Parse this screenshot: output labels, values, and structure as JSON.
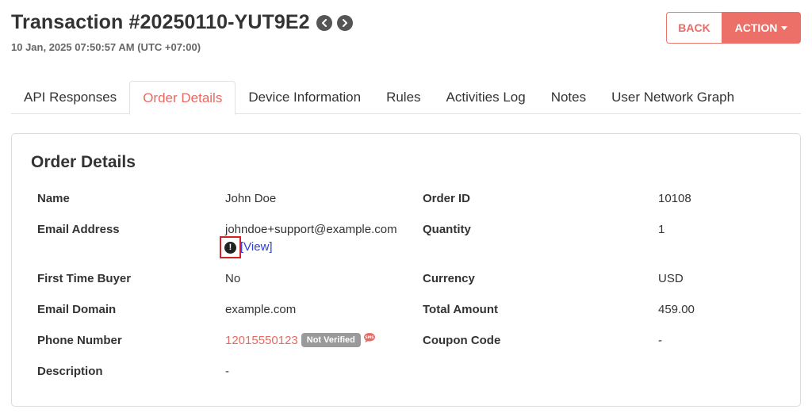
{
  "header": {
    "title": "Transaction #20250110-YUT9E2",
    "timestamp": "10 Jan, 2025 07:50:57 AM (UTC +07:00)",
    "back_label": "BACK",
    "action_label": "ACTION"
  },
  "tabs": [
    {
      "label": "API Responses"
    },
    {
      "label": "Order Details"
    },
    {
      "label": "Device Information"
    },
    {
      "label": "Rules"
    },
    {
      "label": "Activities Log"
    },
    {
      "label": "Notes"
    },
    {
      "label": "User Network Graph"
    }
  ],
  "active_tab": "Order Details",
  "order": {
    "title": "Order Details",
    "left": [
      {
        "label": "Name",
        "value": "John Doe"
      },
      {
        "label": "Email Address",
        "value": "johndoe+support@example.com"
      },
      {
        "label": "First Time Buyer",
        "value": "No"
      },
      {
        "label": "Email Domain",
        "value": "example.com"
      },
      {
        "label": "Phone Number",
        "value": "12015550123"
      },
      {
        "label": "Description",
        "value": "-"
      }
    ],
    "right": [
      {
        "label": "Order ID",
        "value": "10108"
      },
      {
        "label": "Quantity",
        "value": "1"
      },
      {
        "label": "Currency",
        "value": "USD"
      },
      {
        "label": "Total Amount",
        "value": "459.00"
      },
      {
        "label": "Coupon Code",
        "value": "-"
      }
    ],
    "view_link": "[View]",
    "phone_badge": "Not Verified",
    "warning_glyph": "!",
    "sms_icon_text": "SMS"
  },
  "colors": {
    "accent": "#e86a62",
    "action_bg": "#ec6f68",
    "badge_bg": "#9a9a9a",
    "link": "#2b3fd6",
    "highlight_box": "#d61f26"
  },
  "icons": {
    "prev": "chevron-left-icon",
    "next": "chevron-right-icon",
    "warning": "exclamation-circle-icon",
    "sms": "sms-bubble-icon"
  }
}
